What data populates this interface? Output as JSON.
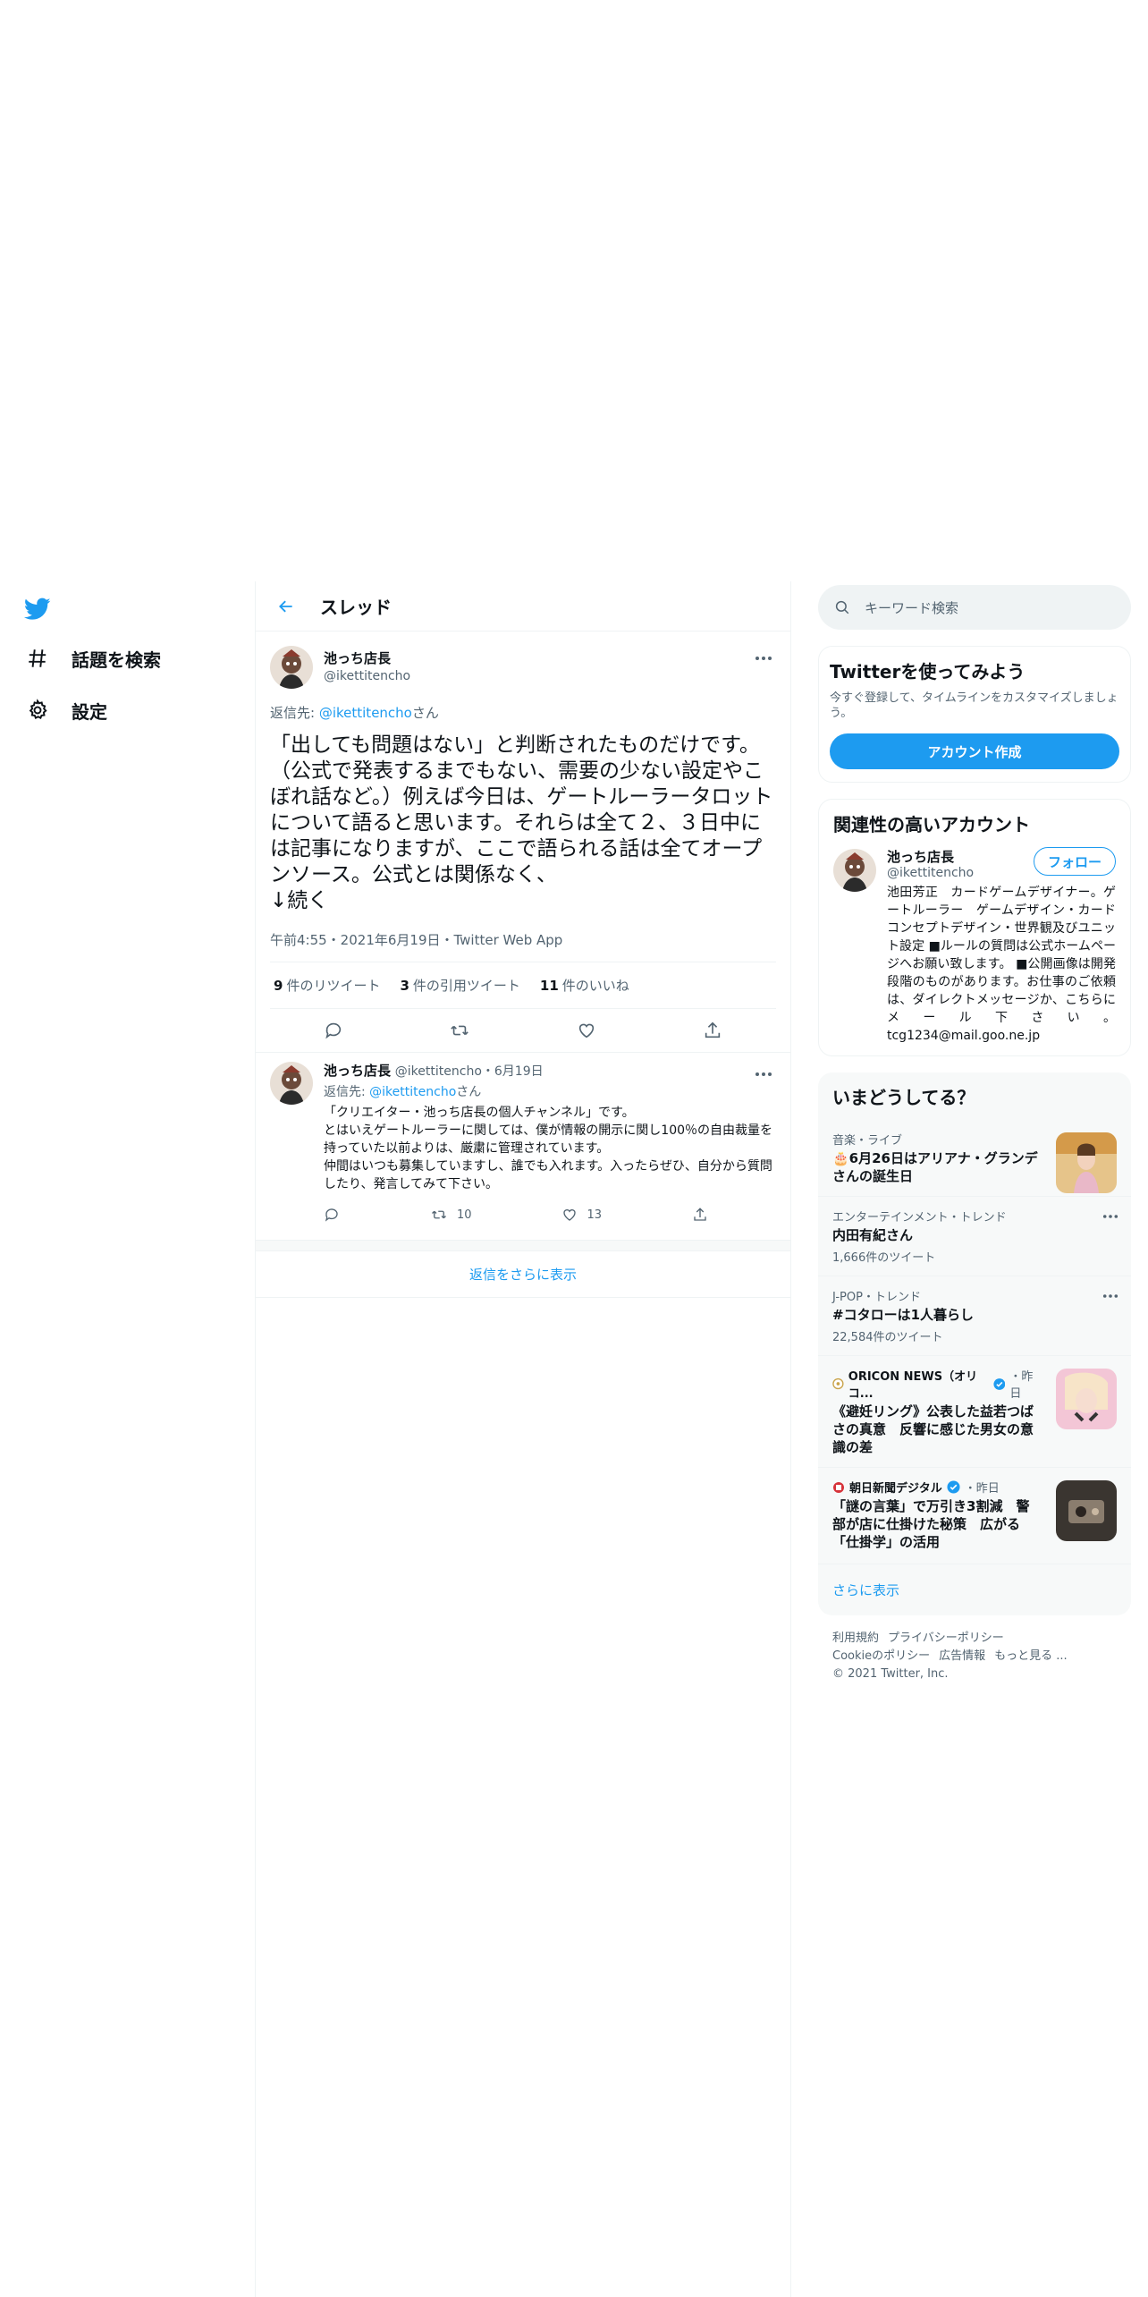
{
  "nav": {
    "items": [
      {
        "label": "話題を検索",
        "icon": "hashtag-icon"
      },
      {
        "label": "設定",
        "icon": "gear-icon"
      }
    ]
  },
  "colors": {
    "accent": "#1d9bf0",
    "text": "#0f1419",
    "muted": "#536471",
    "border": "#eff3f4"
  },
  "thread": {
    "title": "スレッド",
    "main": {
      "display_name": "池っち店長",
      "handle": "@ikettitencho",
      "reply_prefix": "返信先: ",
      "reply_mention": "@ikettitencho",
      "reply_suffix": "さん",
      "text": "「出しても問題はない」と判断されたものだけです。（公式で発表するまでもない、需要の少ない設定やこぼれ話など。）例えば今日は、ゲートルーラータロットについて語ると思います。それらは全て２、３日中には記事になりますが、ここで語られる話は全てオープンソース。公式とは関係なく、\n↓続く",
      "meta": "午前4:55・2021年6月19日・Twitter Web App",
      "retweets_count": "9",
      "retweets_label": "件のリツイート",
      "quotes_count": "3",
      "quotes_label": "件の引用ツイート",
      "likes_count": "11",
      "likes_label": "件のいいね"
    },
    "reply": {
      "display_name": "池っち店長",
      "handle": "@ikettitencho",
      "date": "・6月19日",
      "reply_prefix": "返信先: ",
      "reply_mention": "@ikettitencho",
      "reply_suffix": "さん",
      "text": "「クリエイター・池っち店長の個人チャンネル」です。\nとはいえゲートルーラーに関しては、僕が情報の開示に関し100％の自由裁量を持っていた以前よりは、厳粛に管理されています。\n仲間はいつも募集していますし、誰でも入れます。入ったらぜひ、自分から質問したり、発言してみて下さい。",
      "retweets": "10",
      "likes": "13"
    },
    "show_more_replies": "返信をさらに表示"
  },
  "search": {
    "placeholder": "キーワード検索"
  },
  "signup": {
    "title": "Twitterを使ってみよう",
    "desc": "今すぐ登録して、タイムラインをカスタマイズしましょう。",
    "button": "アカウント作成"
  },
  "related": {
    "title": "関連性の高いアカウント",
    "user": {
      "display_name": "池っち店長",
      "handle": "@ikettitencho",
      "follow": "フォロー",
      "bio": "池田芳正　カードゲームデザイナー。ゲートルーラー　ゲームデザイン・カードコンセプトデザイン・世界観及びユニット設定 ■ルールの質問は公式ホームページへお願い致します。 ■公開画像は開発段階のものがあります。お仕事のご依頼は、ダイレクトメッセージか、こちらにメール下さい。tcg1234@mail.goo.ne.jp"
    }
  },
  "trends": {
    "title": "いまどうしてる？",
    "items": [
      {
        "category": "音楽・ライブ",
        "title": "🎂6月26日はアリアナ・グランデさんの誕生日",
        "count": ""
      },
      {
        "category": "エンターテインメント・トレンド",
        "title": "内田有紀さん",
        "count": "1,666件のツイート"
      },
      {
        "category": "J-POP・トレンド",
        "title": "#コタローは1人暮らし",
        "count": "22,584件のツイート"
      }
    ],
    "news": [
      {
        "source": "ORICON NEWS（オリコ...",
        "time": "・昨日",
        "title": "《避妊リング》公表した益若つばさの真意　反響に感じた男女の意識の差"
      },
      {
        "source": "朝日新聞デジタル",
        "time": "・昨日",
        "title": "「謎の言葉」で万引き3割減　警部が店に仕掛けた秘策　広がる「仕掛学」の活用"
      }
    ],
    "show_more": "さらに表示"
  },
  "footer": {
    "links": [
      "利用規約",
      "プライバシーポリシー",
      "Cookieのポリシー",
      "広告情報",
      "もっと見る ..."
    ],
    "copyright": "© 2021 Twitter, Inc."
  }
}
